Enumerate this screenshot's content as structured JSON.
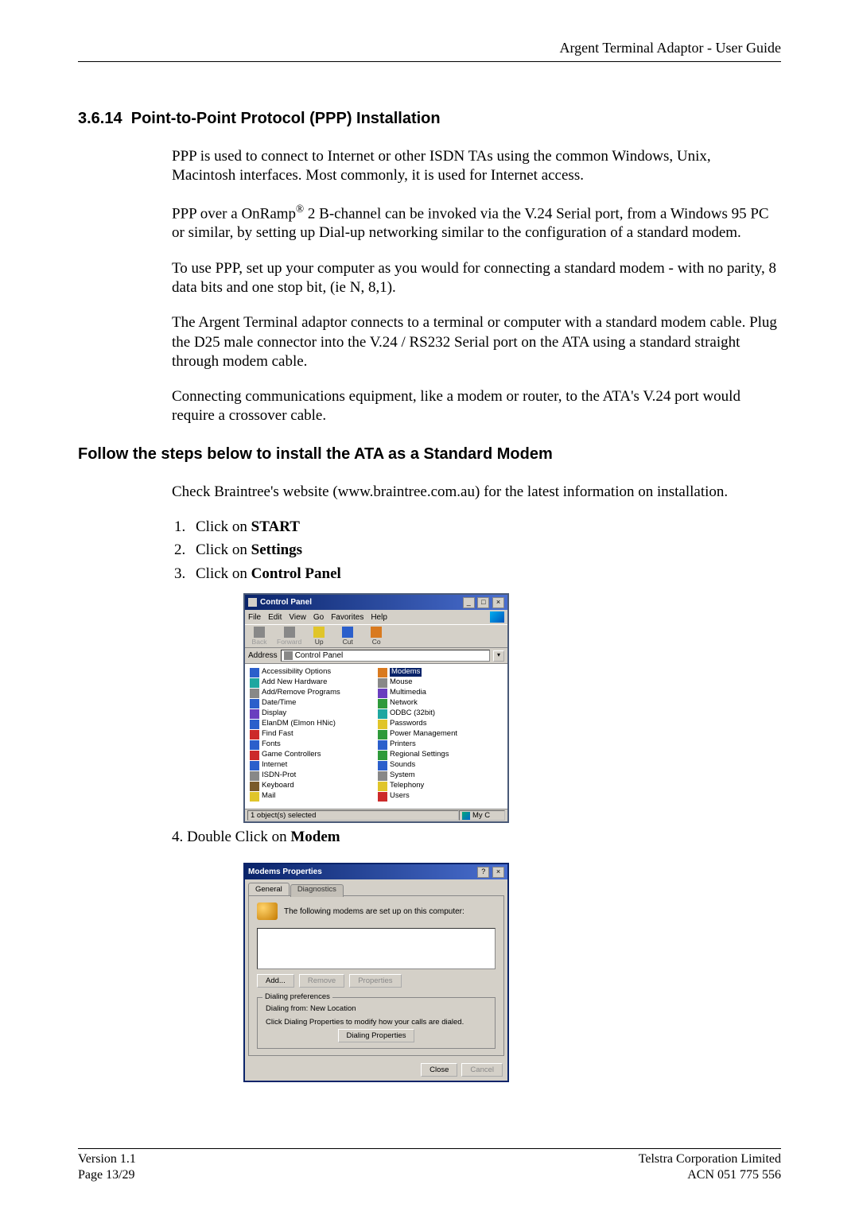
{
  "header": {
    "title": "Argent Terminal Adaptor - User Guide"
  },
  "section": {
    "num": "3.6.14",
    "title": "Point-to-Point Protocol (PPP) Installation",
    "p1": "PPP is used to connect to Internet or other ISDN TAs using the common Windows, Unix, Macintosh interfaces. Most commonly, it is used for Internet access.",
    "p2a": "PPP over a OnRamp",
    "p2sup": "®",
    "p2b": " 2 B-channel can be invoked via the V.24 Serial port, from a Windows 95 PC or similar, by setting up Dial-up networking similar to the configuration of a standard modem.",
    "p3": "To use PPP, set up your computer as you would for connecting a standard modem - with no parity, 8 data bits and one stop bit, (ie N, 8,1).",
    "p4": "The Argent Terminal adaptor connects to a terminal or computer with a standard modem cable.  Plug the D25 male connector into the V.24 / RS232 Serial port on the ATA using a standard straight through modem cable.",
    "p5": "Connecting communications equipment, like a modem or router, to the ATA's V.24 port would require a crossover cable."
  },
  "sub": {
    "title": "Follow the steps below to install the ATA as a Standard Modem",
    "intro": "Check Braintree's website (www.braintree.com.au) for the latest information on installation.",
    "step1a": "Click on ",
    "step1b": "START",
    "step2a": "Click on ",
    "step2b": "Settings",
    "step3a": "Click on ",
    "step3b": "Control Panel",
    "step4a": "4. Double Click on ",
    "step4b": "Modem"
  },
  "cp": {
    "title": "Control Panel",
    "menu": [
      "File",
      "Edit",
      "View",
      "Go",
      "Favorites",
      "Help"
    ],
    "toolbar": {
      "back": "Back",
      "forward": "Forward",
      "up": "Up",
      "cut": "Cut",
      "cop": "Co"
    },
    "address_label": "Address",
    "address_value": "Control Panel",
    "items_left": [
      {
        "n": "Accessibility Options",
        "c": "c-blue"
      },
      {
        "n": "Add New Hardware",
        "c": "c-teal"
      },
      {
        "n": "Add/Remove Programs",
        "c": "c-gray"
      },
      {
        "n": "Date/Time",
        "c": "c-blue"
      },
      {
        "n": "Display",
        "c": "c-violet"
      },
      {
        "n": "ElanDM (Elmon HNic)",
        "c": "c-blue"
      },
      {
        "n": "Find Fast",
        "c": "c-red"
      },
      {
        "n": "Fonts",
        "c": "c-blue"
      },
      {
        "n": "Game Controllers",
        "c": "c-red"
      },
      {
        "n": "Internet",
        "c": "c-blue"
      },
      {
        "n": "ISDN-Prot",
        "c": "c-gray"
      },
      {
        "n": "Keyboard",
        "c": "c-brown"
      },
      {
        "n": "Mail",
        "c": "c-yellow"
      }
    ],
    "items_right": [
      {
        "n": "Modems",
        "c": "c-orange",
        "sel": true
      },
      {
        "n": "Mouse",
        "c": "c-gray"
      },
      {
        "n": "Multimedia",
        "c": "c-violet"
      },
      {
        "n": "Network",
        "c": "c-green"
      },
      {
        "n": "ODBC (32bit)",
        "c": "c-teal"
      },
      {
        "n": "Passwords",
        "c": "c-yellow"
      },
      {
        "n": "Power Management",
        "c": "c-green"
      },
      {
        "n": "Printers",
        "c": "c-blue"
      },
      {
        "n": "Regional Settings",
        "c": "c-green"
      },
      {
        "n": "Sounds",
        "c": "c-blue"
      },
      {
        "n": "System",
        "c": "c-gray"
      },
      {
        "n": "Telephony",
        "c": "c-yellow"
      },
      {
        "n": "Users",
        "c": "c-red"
      }
    ],
    "status_left": "1 object(s) selected",
    "status_right": "My C"
  },
  "mp": {
    "title": "Modems Properties",
    "tab1": "General",
    "tab2": "Diagnostics",
    "intro": "The following modems are set up on this computer:",
    "btn_add": "Add...",
    "btn_remove": "Remove",
    "btn_props": "Properties",
    "group_title": "Dialing preferences",
    "line1": "Dialing from:  New Location",
    "line2": "Click Dialing Properties to modify how your calls are dialed.",
    "btn_dialprops": "Dialing Properties",
    "btn_close": "Close",
    "btn_cancel": "Cancel"
  },
  "footer": {
    "l1": "Version 1.1",
    "l2": "Page 13/29",
    "r1": "Telstra Corporation Limited",
    "r2": "ACN 051 775 556"
  }
}
